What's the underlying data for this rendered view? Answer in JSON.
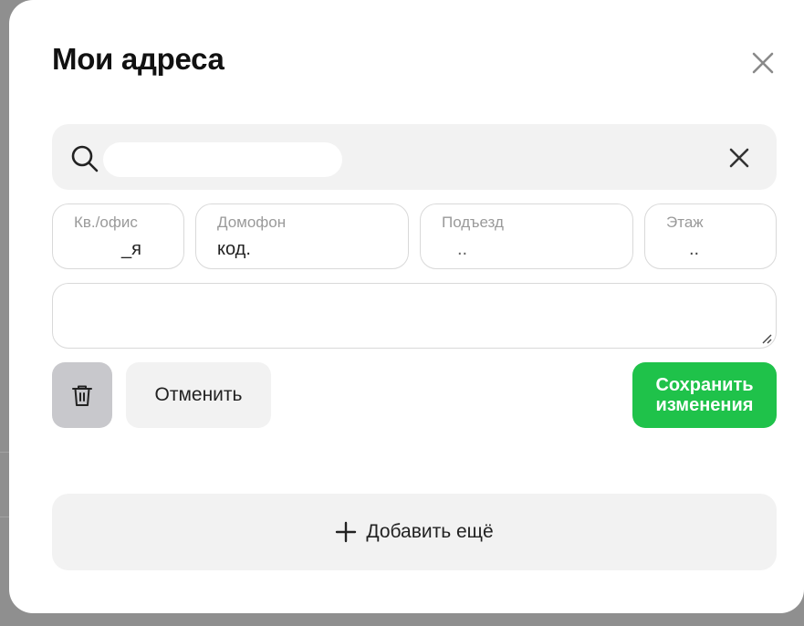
{
  "modal": {
    "title": "Мои адреса"
  },
  "search": {
    "value": ""
  },
  "fields": {
    "apartment": {
      "label": "Кв./офис",
      "value": "_я"
    },
    "intercom": {
      "label": "Домофон",
      "value": "код."
    },
    "entrance": {
      "label": "Подъезд",
      "value": ".."
    },
    "floor": {
      "label": "Этаж",
      "value": ".."
    }
  },
  "comment": {
    "value": ""
  },
  "actions": {
    "cancel_label": "Отменить",
    "save_label_line1": "Сохранить",
    "save_label_line2": "изменения",
    "add_label": "Добавить ещё"
  },
  "colors": {
    "accent": "#1fc24a",
    "surface": "#f2f2f2",
    "delete_bg": "#c8c8cc"
  }
}
